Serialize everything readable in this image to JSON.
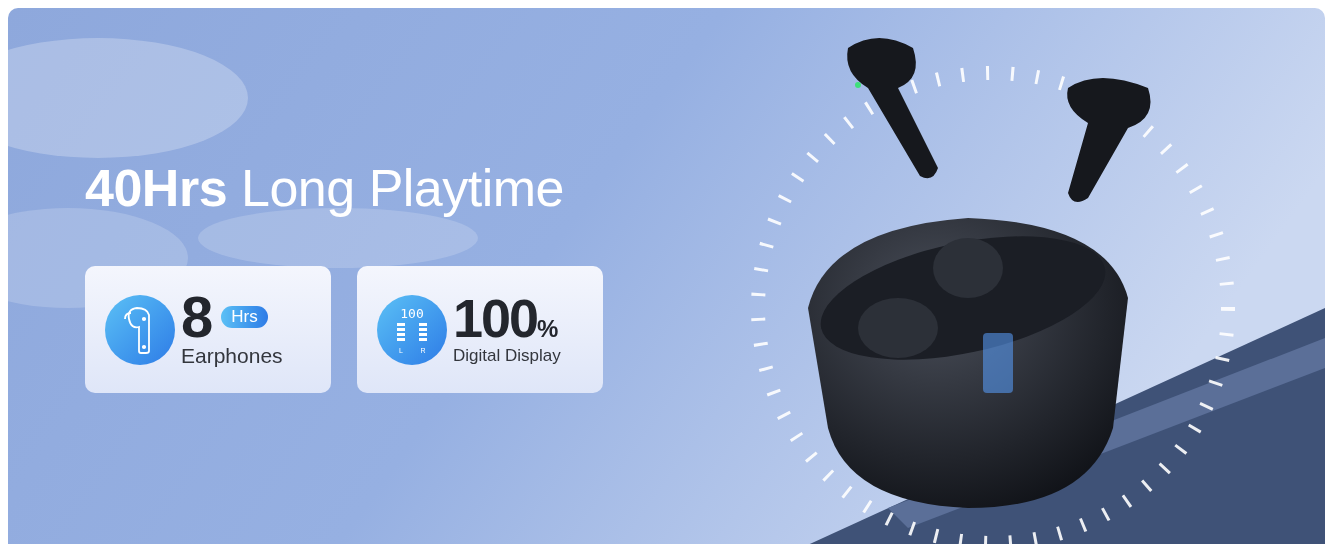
{
  "banner": {
    "headline": "**40Hrs** Long Playtime",
    "cards": [
      {
        "kind": "earphones",
        "value": "8",
        "badge": "Hrs",
        "caption": "Earphones"
      },
      {
        "kind": "display",
        "value": "100",
        "unit": "%",
        "caption": "Digital Display",
        "icon_digits": "100",
        "icon_left": "L",
        "icon_right": "R"
      }
    ]
  }
}
